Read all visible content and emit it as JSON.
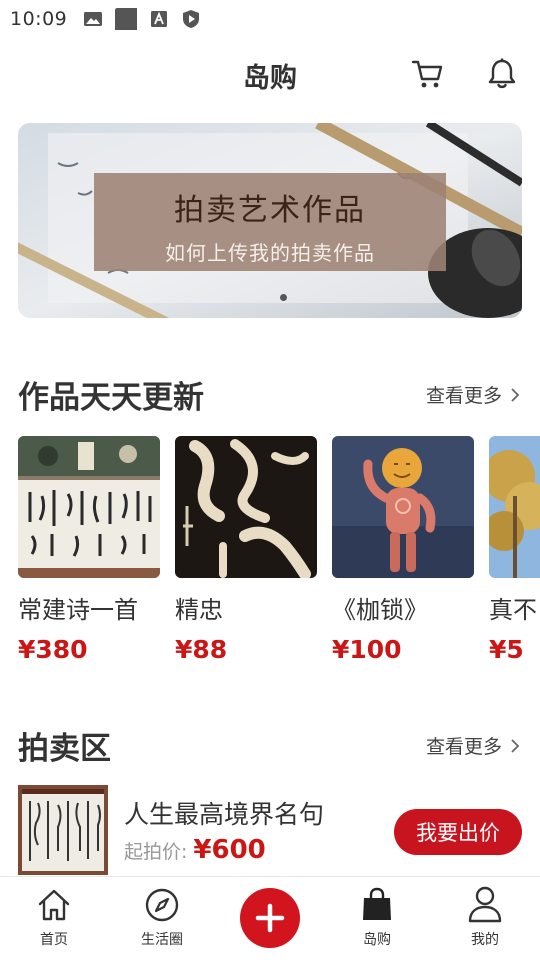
{
  "status_bar": {
    "time": "10:09",
    "icons": [
      "image-icon",
      "square-icon",
      "font-icon",
      "shield-icon"
    ]
  },
  "header": {
    "title": "岛购",
    "icons": [
      "cart-icon",
      "bell-icon"
    ]
  },
  "banner": {
    "title": "拍卖艺术作品",
    "subtitle": "如何上传我的拍卖作品",
    "active_dot": 1,
    "dot_count": 1
  },
  "works_section": {
    "title": "作品天天更新",
    "see_more": "查看更多",
    "items": [
      {
        "name": "常建诗一首",
        "price": "¥380"
      },
      {
        "name": "精忠",
        "price": "¥88"
      },
      {
        "name": "《枷锁》",
        "price": "¥100"
      },
      {
        "name": "真不",
        "price": "¥5"
      }
    ]
  },
  "auction_section": {
    "title": "拍卖区",
    "see_more": "查看更多",
    "items": [
      {
        "name": "人生最高境界名句",
        "price_label": "起拍价:",
        "price": "¥600",
        "action": "我要出价"
      }
    ]
  },
  "tab_bar": {
    "items": [
      {
        "label": "首页",
        "icon": "home-icon"
      },
      {
        "label": "生活圈",
        "icon": "compass-icon"
      },
      {
        "label": "",
        "icon": "plus-icon"
      },
      {
        "label": "岛购",
        "icon": "shopping-bag-icon"
      },
      {
        "label": "我的",
        "icon": "user-icon"
      }
    ]
  },
  "colors": {
    "accent": "#cc1616",
    "publish_button": "#d2141e",
    "text_primary": "#333333",
    "text_muted": "#999999"
  }
}
